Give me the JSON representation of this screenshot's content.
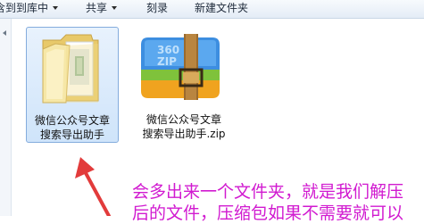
{
  "toolbar": {
    "items": [
      {
        "label": "含到到库中",
        "has_dropdown": true
      },
      {
        "label": "共享",
        "has_dropdown": true
      },
      {
        "label": "刻录",
        "has_dropdown": false
      },
      {
        "label": "新建文件夹",
        "has_dropdown": false
      }
    ]
  },
  "files": [
    {
      "name_line1": "微信公众号文章",
      "name_line2": "搜索导出助手",
      "icon": "folder-icon",
      "selected": true
    },
    {
      "name_line1": "微信公众号文章",
      "name_line2": "搜索导出助手.zip",
      "icon": "zip-archive-icon",
      "selected": false
    }
  ],
  "zip_icon_text": {
    "line1": "360",
    "line2": "ZIP"
  },
  "annotation": {
    "line1": "会多出来一个文件夹，就是我们解压",
    "line2": "后的文件，压缩包如果不需要就可以",
    "color": "#d11ad0"
  },
  "colors": {
    "selection_fill": "#cfe4fa",
    "selection_border": "#84acdd",
    "arrow": "#e23b3b"
  }
}
